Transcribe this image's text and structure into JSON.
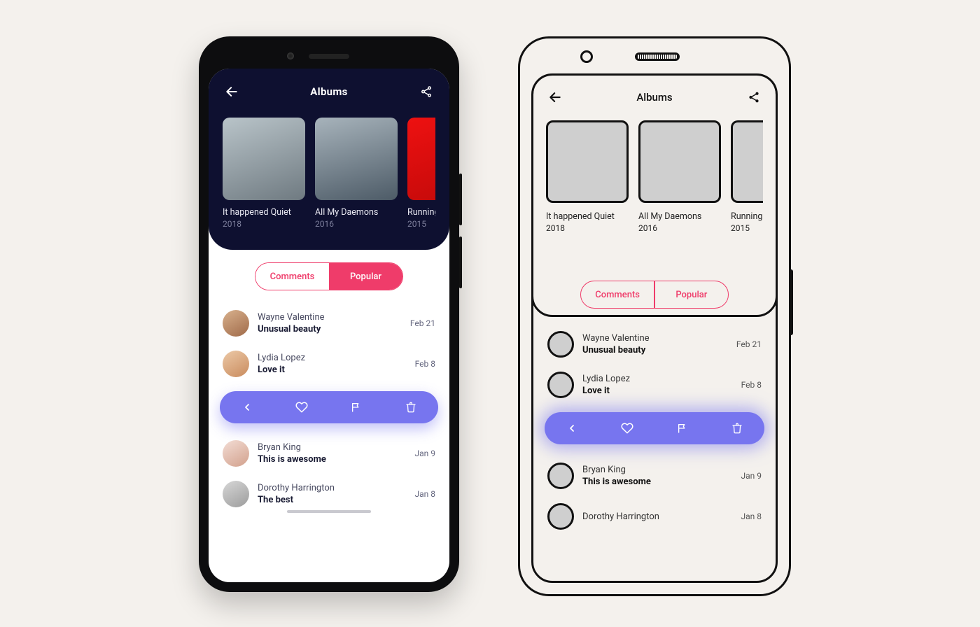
{
  "colors": {
    "hero": "#0e1030",
    "accent": "#ef3c6a",
    "action": "#7775ef"
  },
  "header": {
    "title": "Albums"
  },
  "albums": [
    {
      "title": "It happened Quiet",
      "year": "2018"
    },
    {
      "title": "All My Daemons",
      "year": "2016"
    },
    {
      "title": "Running",
      "year": "2015"
    }
  ],
  "tabs": {
    "left": "Comments",
    "right": "Popular",
    "active": "Popular"
  },
  "comments": [
    {
      "name": "Wayne Valentine",
      "text": "Unusual beauty",
      "date": "Feb 21"
    },
    {
      "name": "Lydia Lopez",
      "text": "Love it",
      "date": "Feb 8"
    },
    {
      "name": "Bryan King",
      "text": "This is awesome",
      "date": "Jan 9"
    },
    {
      "name": "Dorothy Harrington",
      "text": "The best",
      "date": "Jan 8"
    }
  ]
}
